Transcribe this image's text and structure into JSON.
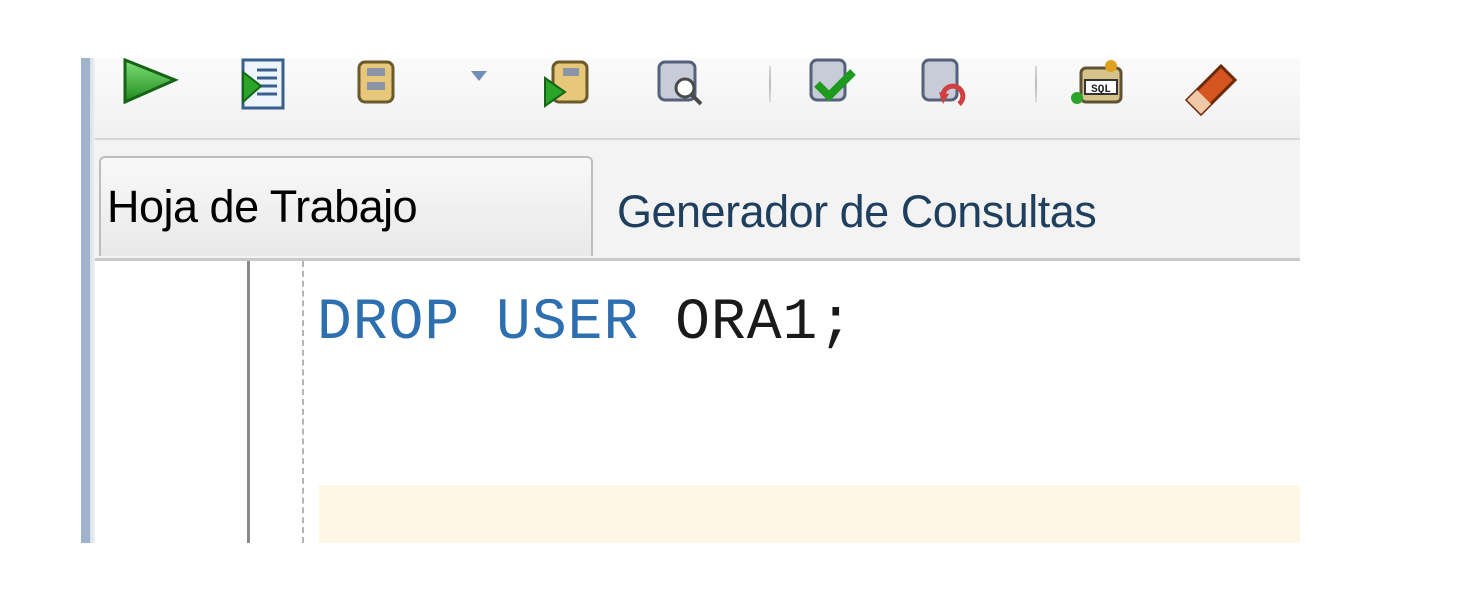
{
  "toolbar": {
    "buttons": [
      {
        "id": "run-statement",
        "icon": "play-icon"
      },
      {
        "id": "run-script",
        "icon": "run-script-icon"
      },
      {
        "id": "commit",
        "icon": "database-icon"
      },
      {
        "id": "rollback",
        "icon": "database-run-icon"
      },
      {
        "id": "tuning",
        "icon": "database-search-icon"
      },
      {
        "id": "check",
        "icon": "database-check-icon"
      },
      {
        "id": "undo",
        "icon": "database-undo-icon"
      },
      {
        "id": "sql",
        "icon": "sql-database-icon"
      },
      {
        "id": "clear",
        "icon": "eraser-icon"
      }
    ]
  },
  "tabs": [
    {
      "label": "Hoja de Trabajo",
      "active": true
    },
    {
      "label": "Generador de Consultas",
      "active": false
    }
  ],
  "editor": {
    "line1": {
      "kw1": "DROP",
      "kw2": "USER",
      "ident": "ORA1",
      "punct": ";"
    }
  },
  "colors": {
    "keyword": "#2e6fb1",
    "current_line": "#fff7e5",
    "tab_text_inactive": "#1f3f5f"
  }
}
